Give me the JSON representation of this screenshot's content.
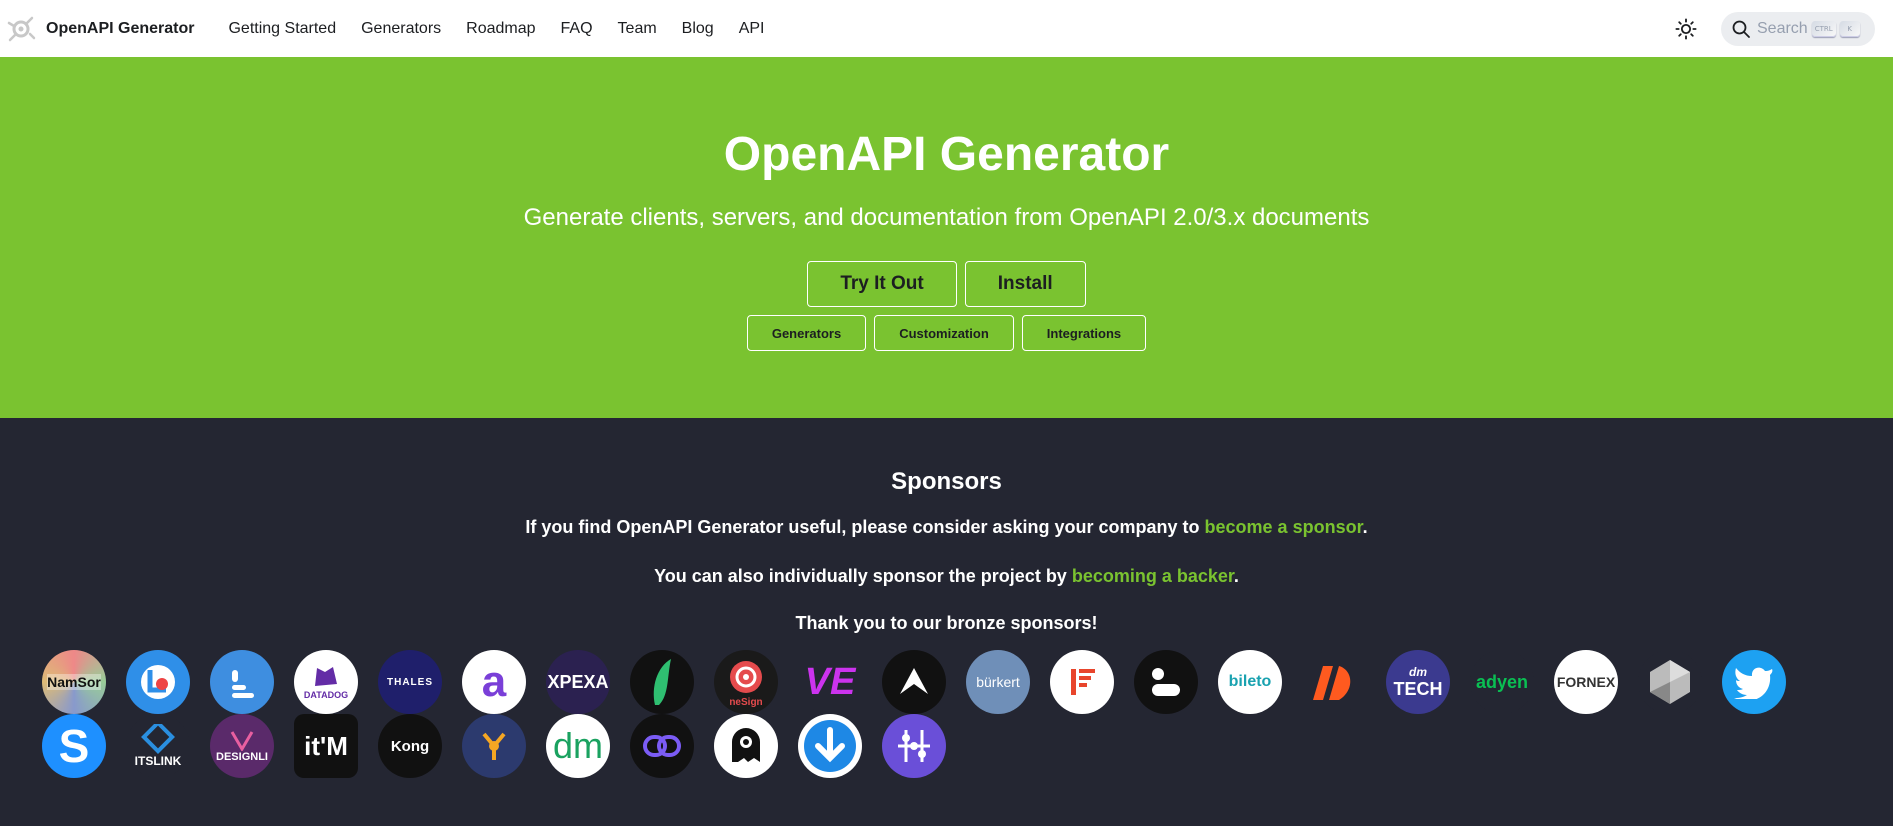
{
  "navbar": {
    "brand_title": "OpenAPI Generator",
    "links": [
      "Getting Started",
      "Generators",
      "Roadmap",
      "FAQ",
      "Team",
      "Blog",
      "API"
    ],
    "search_placeholder": "Search",
    "search_keys": [
      "CTRL",
      "K"
    ],
    "theme_icon": "sun-icon"
  },
  "hero": {
    "title": "OpenAPI Generator",
    "subtitle": "Generate clients, servers, and documentation from OpenAPI 2.0/3.x documents",
    "primary_buttons": [
      "Try It Out",
      "Install"
    ],
    "secondary_buttons": [
      "Generators",
      "Customization",
      "Integrations"
    ],
    "background": "#7ac330"
  },
  "sponsors": {
    "title": "Sponsors",
    "line1_prefix": "If you find OpenAPI Generator useful, please consider asking your company to ",
    "line1_link": "become a sponsor",
    "line1_suffix": ".",
    "line2_prefix": "You can also individually sponsor the project by ",
    "line2_link": "becoming a backer",
    "line2_suffix": ".",
    "line3": "Thank you to our bronze sponsors!",
    "link_color": "#7ac330",
    "logos": [
      {
        "name": "namsor",
        "text": "NamSor"
      },
      {
        "name": "lb",
        "text": ""
      },
      {
        "name": "bars",
        "text": ""
      },
      {
        "name": "datadog",
        "text": "DATADOG"
      },
      {
        "name": "thales",
        "text": "THALES"
      },
      {
        "name": "a",
        "text": "a"
      },
      {
        "name": "xpexa",
        "text": "XPEXA"
      },
      {
        "name": "leaf",
        "text": ""
      },
      {
        "name": "onesignal",
        "text": "neSign"
      },
      {
        "name": "ve",
        "text": "VE"
      },
      {
        "name": "arrow",
        "text": ""
      },
      {
        "name": "burkert",
        "text": "bürkert"
      },
      {
        "name": "f",
        "text": ""
      },
      {
        "name": "dots",
        "text": ""
      },
      {
        "name": "bileto",
        "text": "bileto"
      },
      {
        "name": "wave",
        "text": ""
      },
      {
        "name": "dmtech",
        "text": "TECH"
      },
      {
        "name": "adyen",
        "text": "adyen"
      },
      {
        "name": "fornex",
        "text": "FORNEX"
      },
      {
        "name": "gem",
        "text": ""
      },
      {
        "name": "twitter",
        "text": ""
      },
      {
        "name": "s",
        "text": "S"
      },
      {
        "name": "itslink",
        "text": "ITSLINK"
      },
      {
        "name": "designli",
        "text": "DESIGNLI"
      },
      {
        "name": "itm",
        "text": "it'M"
      },
      {
        "name": "kong",
        "text": "Kong"
      },
      {
        "name": "fork",
        "text": ""
      },
      {
        "name": "dm",
        "text": "dm"
      },
      {
        "name": "link",
        "text": ""
      },
      {
        "name": "ghost",
        "text": ""
      },
      {
        "name": "download",
        "text": ""
      },
      {
        "name": "nodes",
        "text": ""
      }
    ]
  }
}
